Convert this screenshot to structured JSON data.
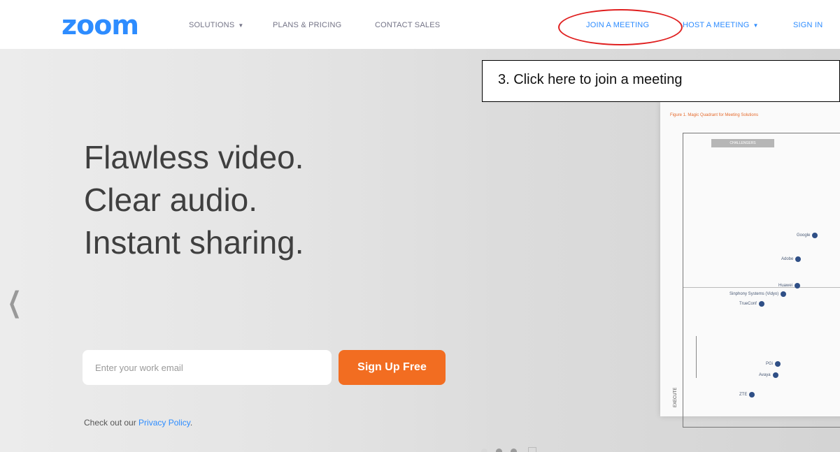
{
  "nav": {
    "logo": "zoom",
    "solutions_label": "SOLUTIONS",
    "plans_label": "PLANS & PRICING",
    "contact_label": "CONTACT SALES",
    "join_label": "JOIN A MEETING",
    "host_label": "HOST A MEETING",
    "signin_label": "SIGN IN"
  },
  "hero": {
    "line1": "Flawless video.",
    "line2": "Clear audio.",
    "line3": "Instant sharing.",
    "email_placeholder": "Enter your work email",
    "signup_label": "Sign Up Free",
    "privacy_prefix": "Check out our ",
    "privacy_link": "Privacy Policy",
    "privacy_suffix": "."
  },
  "card": {
    "title": "Figure 1. Magic Quadrant for Meeting Solutions",
    "quadrant_label": "CHALLENGERS",
    "axis_label": "EXECUTE",
    "vendors": [
      "Google",
      "Adobe",
      "Huawei",
      "Sinphony Systems (Vidyo)",
      "TrueConf",
      "PGi",
      "Avaya",
      "ZTE"
    ]
  },
  "annotation": {
    "text": "3.  Click here to join a meeting"
  },
  "colors": {
    "brand_blue": "#2d8cff",
    "signup_orange": "#f26d21",
    "highlight_red": "#e02020"
  }
}
